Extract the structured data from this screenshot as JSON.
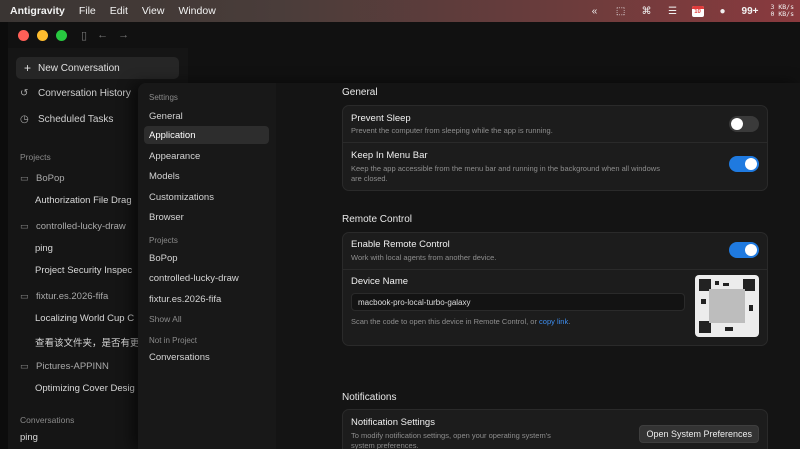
{
  "menubar": {
    "app_name": "Antigravity",
    "menus": [
      "File",
      "Edit",
      "View",
      "Window"
    ],
    "notification_count": "99+",
    "calendar_day": "10",
    "net_up": "3 KB/s",
    "net_down": "0 KB/s"
  },
  "sidebar": {
    "new_conversation": "New Conversation",
    "nav": [
      {
        "label": "Conversation History",
        "icon": "history-icon"
      },
      {
        "label": "Scheduled Tasks",
        "icon": "clock-icon"
      }
    ],
    "projects_header": "Projects",
    "projects": [
      {
        "name": "BoPop",
        "items": [
          "Authorization File Drag"
        ]
      },
      {
        "name": "controlled-lucky-draw",
        "items": [
          "ping",
          "Project Security Inspec"
        ]
      },
      {
        "name": "fixtur.es.2026-fifa",
        "items": [
          "Localizing World Cup C",
          "查看该文件夹，是否有更"
        ]
      },
      {
        "name": "Pictures-APPINN",
        "items": [
          "Optimizing Cover Desig"
        ]
      }
    ],
    "conversations_header": "Conversations",
    "conversations": [
      "ping"
    ]
  },
  "settings_nav": {
    "header": "Settings",
    "items": [
      "General",
      "Application",
      "Appearance",
      "Models",
      "Customizations",
      "Browser"
    ],
    "active": "Application",
    "projects_header": "Projects",
    "projects": [
      "BoPop",
      "controlled-lucky-draw",
      "fixtur.es.2026-fifa"
    ],
    "show_all": "Show All",
    "not_in_project_header": "Not in Project",
    "not_in_project": [
      "Conversations"
    ]
  },
  "content": {
    "general": {
      "heading": "General",
      "prevent_sleep": {
        "title": "Prevent Sleep",
        "desc": "Prevent the computer from sleeping while the app is running.",
        "enabled": false
      },
      "keep_in_menu_bar": {
        "title": "Keep In Menu Bar",
        "desc1": "Keep the app accessible from the menu bar and running in the background when all windows",
        "desc2": "are closed.",
        "enabled": true
      }
    },
    "remote": {
      "heading": "Remote Control",
      "enable": {
        "title": "Enable Remote Control",
        "desc": "Work with local agents from another device.",
        "enabled": true
      },
      "device_name_label": "Device Name",
      "device_name_value": "macbook-pro-local-turbo-galaxy",
      "scan_text": "Scan the code to open this device in Remote Control, or ",
      "copy_link": "copy link",
      "scan_suffix": "."
    },
    "notifications": {
      "heading": "Notifications",
      "title": "Notification Settings",
      "desc1": "To modify notification settings, open your operating system's",
      "desc2": "system preferences.",
      "button": "Open System Preferences"
    }
  },
  "colors": {
    "accent": "#1f7ae0",
    "link": "#3d8ef0",
    "close": "#ff5f57",
    "minimize": "#febc2e",
    "zoom": "#28c840"
  }
}
